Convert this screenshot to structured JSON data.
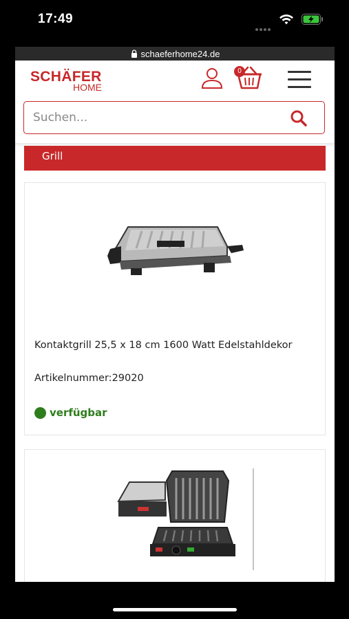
{
  "status_bar": {
    "time": "17:49"
  },
  "browser": {
    "url": "schaeferhome24.de"
  },
  "header": {
    "logo_main": "SCHÄFER",
    "logo_sub": "HOME",
    "cart_count": "0"
  },
  "search": {
    "placeholder": "Suchen..."
  },
  "category": {
    "label": "Grill"
  },
  "products": [
    {
      "title": "Kontaktgrill 25,5 x 18 cm 1600 Watt Edelstahldekor",
      "sku": "Artikelnummer:29020",
      "availability": "verfügbar"
    }
  ],
  "colors": {
    "brand": "#c7282a",
    "available": "#2e7d1c"
  }
}
